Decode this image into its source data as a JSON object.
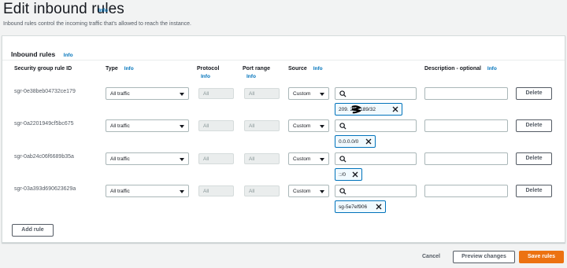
{
  "header": {
    "title": "Edit inbound rules",
    "info": "Info",
    "subtitle": "Inbound rules control the incoming traffic that's allowed to reach the instance."
  },
  "panel": {
    "title": "Inbound rules",
    "info": "Info",
    "columns": {
      "rule_id": "Security group rule ID",
      "type": "Type",
      "protocol": "Protocol",
      "port_range": "Port range",
      "source": "Source",
      "description": "Description - optional",
      "info": "Info"
    },
    "rules": [
      {
        "id": "sgr-0e38beb04732ce179",
        "type": "All traffic",
        "protocol": "All",
        "port": "All",
        "source": "Custom",
        "token": "209.  228.189/32",
        "delete": "Delete"
      },
      {
        "id": "sgr-0a2201949cf5bc675",
        "type": "All traffic",
        "protocol": "All",
        "port": "All",
        "source": "Custom",
        "token": "0.0.0.0/0",
        "delete": "Delete"
      },
      {
        "id": "sgr-0ab24c06f6689b35a",
        "type": "All traffic",
        "protocol": "All",
        "port": "All",
        "source": "Custom",
        "token": "::/0",
        "delete": "Delete"
      },
      {
        "id": "sgr-03a393d690623629a",
        "type": "All traffic",
        "protocol": "All",
        "port": "All",
        "source": "Custom",
        "token": "sg-5e7ef906",
        "delete": "Delete"
      }
    ],
    "add_rule": "Add rule"
  },
  "footer": {
    "cancel": "Cancel",
    "preview": "Preview changes",
    "save": "Save rules"
  },
  "colors": {
    "accent": "#ec7211",
    "link": "#0073bb",
    "token_border": "#0073bb"
  },
  "icons": [
    "search-icon",
    "close-icon",
    "caret-down-icon"
  ]
}
